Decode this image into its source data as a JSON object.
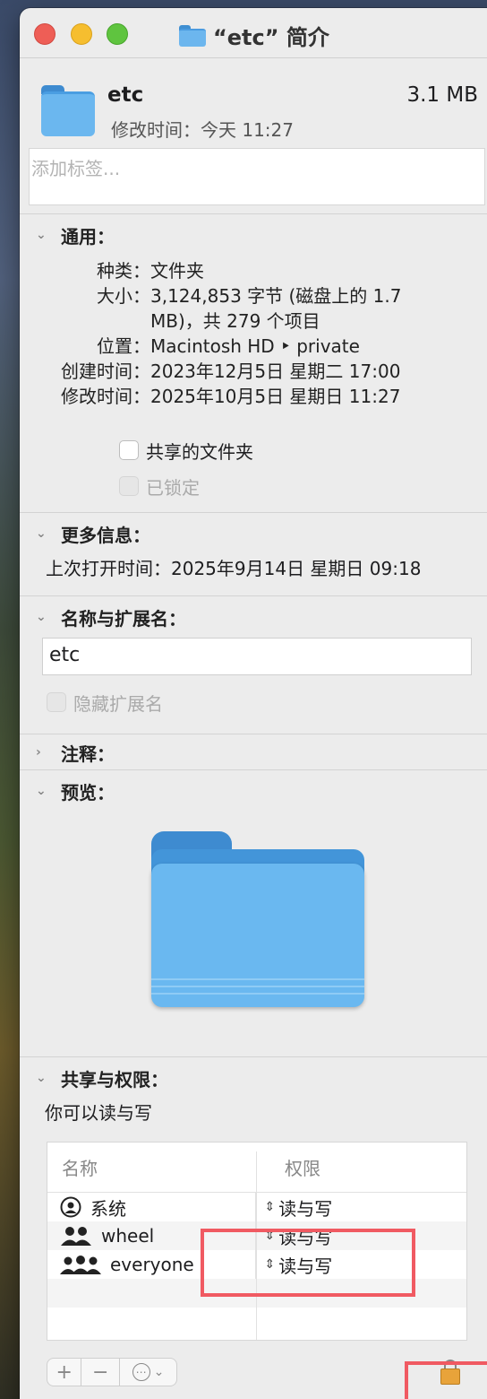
{
  "window": {
    "title": "“etc” 简介"
  },
  "header": {
    "name": "etc",
    "size": "3.1 MB",
    "modified_line": "修改时间：今天 11:27"
  },
  "tags": {
    "placeholder": "添加标签..."
  },
  "general": {
    "title": "通用：",
    "rows": [
      {
        "key": "种类：",
        "value": "文件夹"
      },
      {
        "key": "大小：",
        "value": "3,124,853 字节 (磁盘上的 1.7 MB)，共 279 个项目"
      },
      {
        "key": "位置：",
        "value": "Macintosh HD ‣ private"
      },
      {
        "key": "创建时间：",
        "value": "2023年12月5日 星期二 17:00"
      },
      {
        "key": "修改时间：",
        "value": "2025年10月5日 星期日 11:27"
      }
    ],
    "shared_folder": "共享的文件夹",
    "locked": "已锁定"
  },
  "more_info": {
    "title": "更多信息：",
    "last_opened": "上次打开时间：2025年9月14日 星期日 09:18"
  },
  "name_ext": {
    "title": "名称与扩展名：",
    "value": "etc",
    "hide_ext": "隐藏扩展名"
  },
  "comments": {
    "title": "注释："
  },
  "preview": {
    "title": "预览："
  },
  "sharing": {
    "title": "共享与权限：",
    "summary": "你可以读与写",
    "col_name": "名称",
    "col_priv": "权限",
    "rows": [
      {
        "name": "系统",
        "priv": "读与写",
        "icon": "user-circle-icon"
      },
      {
        "name": "wheel",
        "priv": "读与写",
        "icon": "group-icon"
      },
      {
        "name": "everyone",
        "priv": "读与写",
        "icon": "everyone-icon"
      }
    ],
    "toolbar": {
      "add": "+",
      "remove": "−",
      "action": "⋯"
    }
  }
}
